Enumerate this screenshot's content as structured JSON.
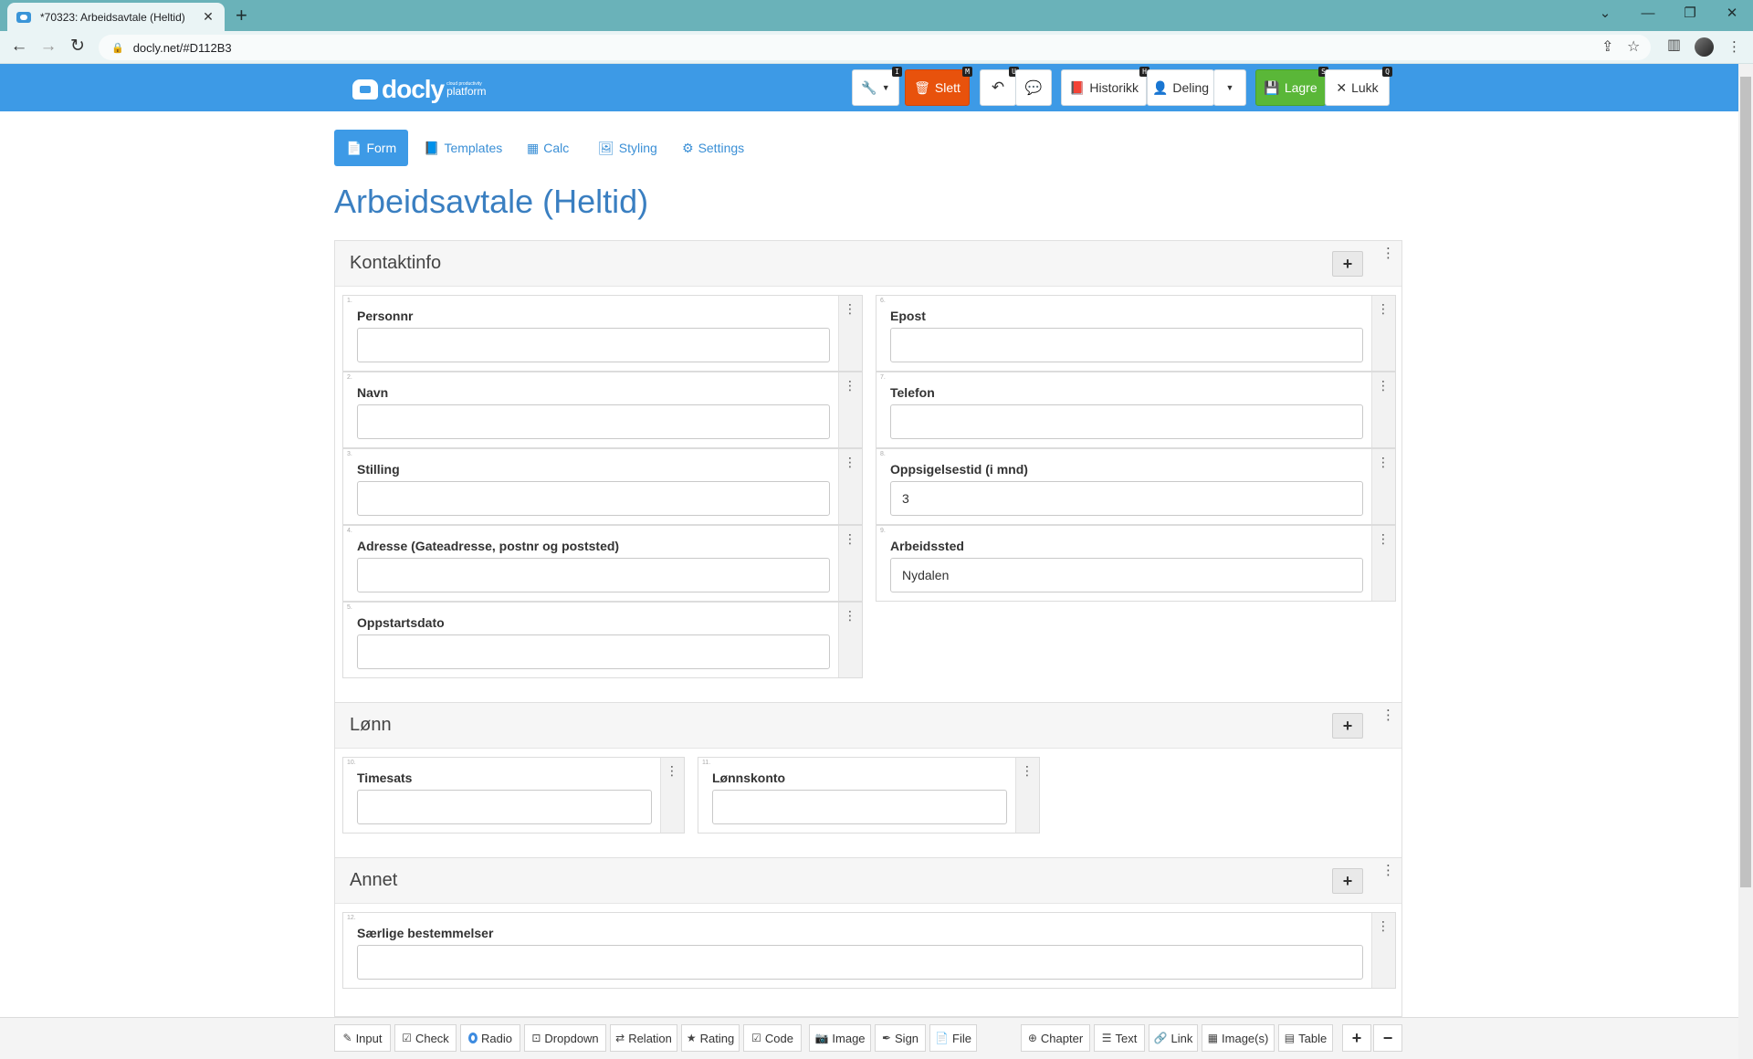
{
  "browser": {
    "tab_title": "*70323: Arbeidsavtale (Heltid)",
    "url": "docly.net/#D112B3"
  },
  "header": {
    "logo_text": "docly",
    "logo_tagline": "cloud productivity",
    "logo_platform": "platform",
    "buttons": {
      "delete": "Slett",
      "history": "Historikk",
      "share": "Deling",
      "save": "Lagre",
      "close": "Lukk"
    },
    "shortcuts": {
      "tools": "I",
      "delete": "M",
      "undo": "U",
      "history": "H",
      "save": "S",
      "close": "Q"
    },
    "colors": {
      "bar": "#3d9ae6",
      "delete": "#e8520c",
      "save": "#5ab738",
      "comment_icon": "#f0a020"
    }
  },
  "mode_tabs": [
    {
      "label": "Form",
      "icon": "file-icon",
      "active": true
    },
    {
      "label": "Templates",
      "icon": "book-icon",
      "active": false
    },
    {
      "label": "Calc",
      "icon": "calc-icon",
      "active": false
    },
    {
      "label": "Styling",
      "icon": "picture-icon",
      "active": false
    },
    {
      "label": "Settings",
      "icon": "gear-icon",
      "active": false
    }
  ],
  "document_title": "Arbeidsavtale (Heltid)",
  "sections": [
    {
      "title": "Kontaktinfo",
      "fields": [
        {
          "num": "1.",
          "label": "Personnr",
          "value": ""
        },
        {
          "num": "2.",
          "label": "Navn",
          "value": ""
        },
        {
          "num": "3.",
          "label": "Stilling",
          "value": ""
        },
        {
          "num": "4.",
          "label": "Adresse (Gateadresse, postnr og poststed)",
          "value": ""
        },
        {
          "num": "5.",
          "label": "Oppstartsdato",
          "value": ""
        },
        {
          "num": "6.",
          "label": "Epost",
          "value": ""
        },
        {
          "num": "7.",
          "label": "Telefon",
          "value": ""
        },
        {
          "num": "8.",
          "label": "Oppsigelsestid (i mnd)",
          "value": "3"
        },
        {
          "num": "9.",
          "label": "Arbeidssted",
          "value": "Nydalen"
        }
      ]
    },
    {
      "title": "Lønn",
      "fields": [
        {
          "num": "10.",
          "label": "Timesats",
          "value": ""
        },
        {
          "num": "11.",
          "label": "Lønnskonto",
          "value": ""
        }
      ]
    },
    {
      "title": "Annet",
      "fields": [
        {
          "num": "12.",
          "label": "Særlige bestemmelser",
          "value": ""
        }
      ]
    }
  ],
  "bottom_toolbar": {
    "items": [
      "Input",
      "Check",
      "Radio",
      "Dropdown",
      "Relation",
      "Rating",
      "Code",
      "Image",
      "Sign",
      "File",
      "Chapter",
      "Text",
      "Link",
      "Image(s)",
      "Table"
    ]
  }
}
